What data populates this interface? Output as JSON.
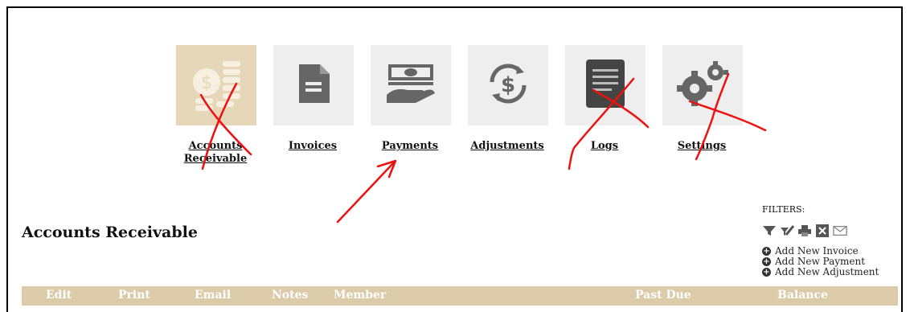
{
  "nav": {
    "items": [
      {
        "label": "Accounts Receivable",
        "icon": "coins-dollar-icon",
        "active": true
      },
      {
        "label": "Invoices",
        "icon": "document-icon",
        "active": false
      },
      {
        "label": "Payments",
        "icon": "cash-hand-icon",
        "active": false
      },
      {
        "label": "Adjustments",
        "icon": "dollar-cycle-icon",
        "active": false
      },
      {
        "label": "Logs",
        "icon": "log-list-icon",
        "active": false
      },
      {
        "label": "Settings",
        "icon": "gears-icon",
        "active": false
      }
    ]
  },
  "page": {
    "title": "Accounts Receivable"
  },
  "filters": {
    "label": "FILTERS:",
    "icons": [
      "filter-icon",
      "clear-filter-icon",
      "print-icon",
      "close-icon",
      "email-icon"
    ],
    "actions": [
      {
        "label": "Add New Invoice"
      },
      {
        "label": "Add New Payment"
      },
      {
        "label": "Add New Adjustment"
      }
    ]
  },
  "table": {
    "columns": [
      "Edit",
      "Print",
      "Email",
      "Notes",
      "Member",
      "Past Due",
      "Balance"
    ]
  },
  "colors": {
    "active_tile": "#e6d7b9",
    "tile": "#eeeeee",
    "header_bg": "#dccba9",
    "annotation": "#ee1111"
  }
}
